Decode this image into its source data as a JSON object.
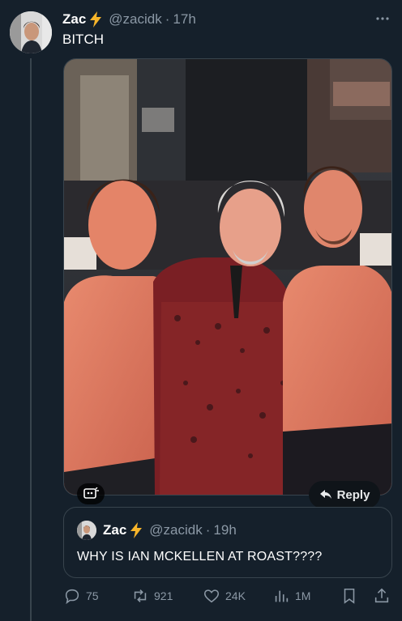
{
  "author": {
    "name": "Zac",
    "handle": "@zacidk",
    "separator": "·",
    "time": "17h",
    "badge_icon": "lightning-bolt-icon"
  },
  "tweet": {
    "text": "BITCH"
  },
  "media": {
    "alt_icon": "alt-text-icon",
    "reply_label": "Reply"
  },
  "quote": {
    "name": "Zac",
    "handle": "@zacidk",
    "separator": "·",
    "time": "19h",
    "text": "WHY IS IAN MCKELLEN AT ROAST????"
  },
  "actions": {
    "replies": "75",
    "retweets": "921",
    "likes": "24K",
    "views": "1M"
  },
  "colors": {
    "background": "#15202b",
    "secondary_text": "#8b98a5",
    "border": "#38444d",
    "bolt": "#f7b52a"
  }
}
